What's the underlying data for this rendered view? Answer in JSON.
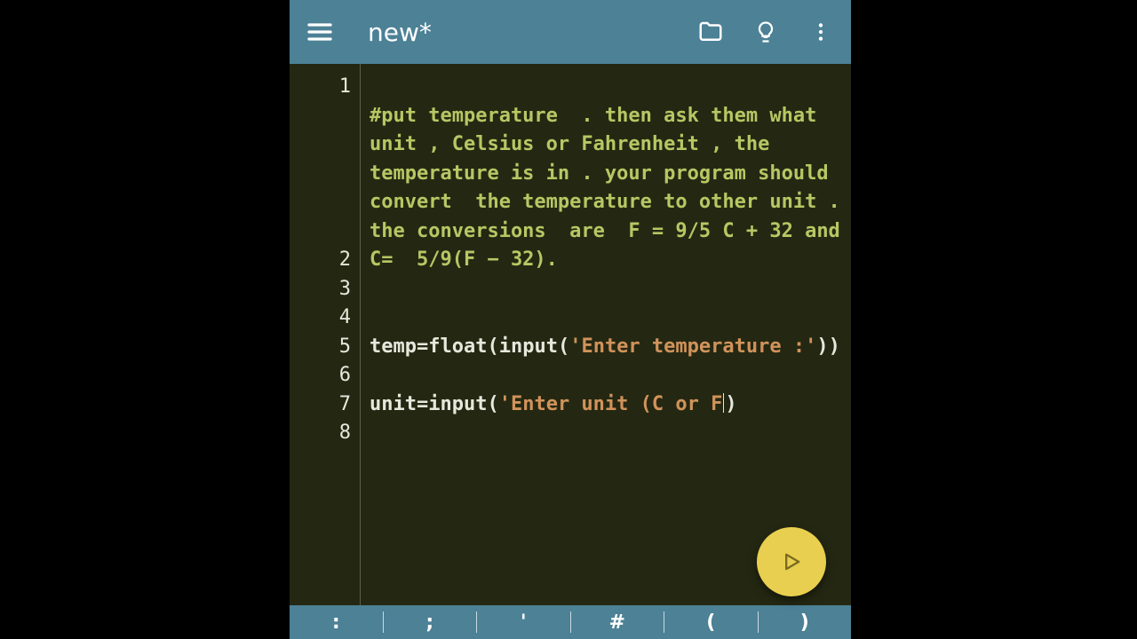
{
  "appbar": {
    "title": "new*"
  },
  "code": {
    "line_numbers": [
      "1",
      "2",
      "3",
      "4",
      "5",
      "6",
      "7",
      "8"
    ],
    "line1_comment": "#put temperature  . then ask them what unit , Celsius or Fahrenheit , the temperature is in . your program should convert  the temperature to other unit . the conversions  are  F = 9/5 C + 32 and  C=  5/9(F − 32).",
    "l3_ident": "temp",
    "l3_eq": "=",
    "l3_float": "float",
    "l3_p1": "(",
    "l3_input": "input",
    "l3_p2": "(",
    "l3_str": "'Enter temperature :'",
    "l3_p3": ")",
    "l3_p4": ")",
    "l4_ident": "unit",
    "l4_eq": "=",
    "l4_input": "input",
    "l4_p1": "(",
    "l4_str": "'Enter unit (C or F",
    "l4_p2": ")"
  },
  "keybar": {
    "keys": [
      ":",
      ";",
      "'",
      "#",
      "(",
      ")"
    ]
  }
}
